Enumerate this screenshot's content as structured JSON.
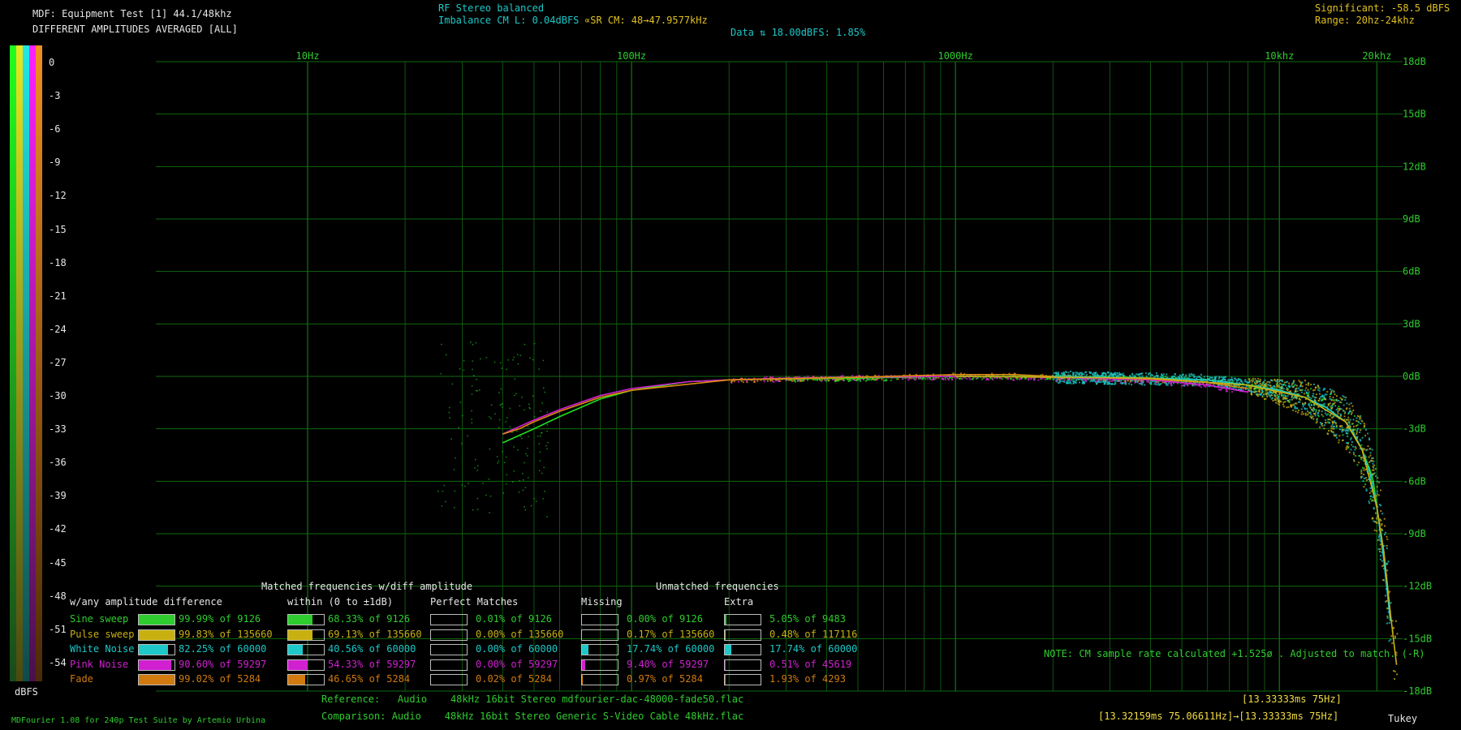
{
  "header": {
    "title": "MDF: Equipment Test [1] 44.1/48khz",
    "subtitle": "DIFFERENT AMPLITUDES AVERAGED [ALL]",
    "rf_line1": "RF Stereo balanced",
    "rf_line2": "Imbalance CM L: 0.04dBFS",
    "sr_cm": "∝SR CM: 48→47.9577kHz",
    "data_line": "Data ⇅ 18.00dBFS: 1.85%",
    "significant": "Significant: -58.5 dBFS",
    "range": "Range: 20hz-24khz"
  },
  "scale": {
    "labels": [
      "0",
      "-3",
      "-6",
      "-9",
      "-12",
      "-15",
      "-18",
      "-21",
      "-24",
      "-27",
      "-30",
      "-33",
      "-36",
      "-39",
      "-42",
      "-45",
      "-48",
      "-51",
      "-54"
    ],
    "unit": "dBFS"
  },
  "chart_data": {
    "type": "scatter",
    "x_scale": "log",
    "x_ticks": [
      "10Hz",
      "100Hz",
      "1000Hz",
      "10khz",
      "20khz"
    ],
    "x_tick_values": [
      10,
      100,
      1000,
      10000,
      20000
    ],
    "y_ticks": [
      "18dB",
      "15dB",
      "12dB",
      "9dB",
      "6dB",
      "3dB",
      "0dB",
      "-3dB",
      "-6dB",
      "-9dB",
      "-12dB",
      "-15dB",
      "-18dB"
    ],
    "y_tick_values": [
      18,
      15,
      12,
      9,
      6,
      3,
      0,
      -3,
      -6,
      -9,
      -12,
      -15,
      -18
    ],
    "xlim": [
      3.4,
      24000
    ],
    "ylim": [
      -18,
      18
    ],
    "grid": true,
    "series": [
      {
        "name": "Sine sweep",
        "color": "#20e020",
        "x": [
          40,
          50,
          60,
          80,
          100,
          150,
          200,
          300,
          500,
          1000,
          2000,
          4000,
          6000,
          8000,
          10000,
          12000,
          14000,
          16000,
          17000,
          18000,
          19000,
          19500,
          20000
        ],
        "y": [
          -3.8,
          -3.0,
          -2.3,
          -1.3,
          -0.8,
          -0.3,
          -0.2,
          -0.15,
          -0.1,
          0.0,
          0.0,
          -0.1,
          -0.2,
          -0.5,
          -0.8,
          -1.2,
          -1.8,
          -2.6,
          -3.3,
          -4.2,
          -5.3,
          -6.0,
          -7.5
        ]
      },
      {
        "name": "Pink Noise",
        "color": "#d020d0",
        "x": [
          40,
          50,
          60,
          80,
          100,
          150,
          200,
          300,
          500,
          1000,
          2000,
          4000,
          6000,
          8000
        ],
        "y": [
          -3.3,
          -2.5,
          -1.9,
          -1.1,
          -0.7,
          -0.3,
          -0.2,
          -0.1,
          -0.05,
          0.0,
          -0.05,
          -0.2,
          -0.5,
          -0.9
        ]
      },
      {
        "name": "Fade",
        "color": "#e08a10",
        "x": [
          40,
          45,
          50,
          60,
          80,
          100,
          200,
          500,
          1000,
          1500,
          2000,
          4000,
          6000,
          8000
        ],
        "y": [
          -3.3,
          -3.0,
          -2.6,
          -2.0,
          -1.2,
          -0.8,
          -0.2,
          -0.05,
          0.1,
          0.1,
          0.0,
          -0.15,
          -0.35,
          -0.7
        ]
      },
      {
        "name": "White Noise",
        "color": "#1ec8c8",
        "x": [
          2000,
          4000,
          6000,
          8000,
          10000,
          12000,
          14000,
          16000,
          17000,
          18000,
          19000,
          20000,
          21000,
          22000
        ],
        "y": [
          0.0,
          -0.1,
          -0.2,
          -0.5,
          -0.8,
          -1.2,
          -1.8,
          -2.6,
          -3.3,
          -4.2,
          -5.5,
          -7.5,
          -10.5,
          -14.0
        ]
      },
      {
        "name": "Pulse sweep",
        "color": "#c8b010",
        "x": [
          1000,
          4000,
          8000,
          12000,
          16000,
          18000,
          20000,
          21000,
          22000,
          23000
        ],
        "y": [
          0.0,
          -0.1,
          -0.5,
          -1.2,
          -2.6,
          -4.2,
          -7.5,
          -10.0,
          -13.5,
          -16.5
        ]
      }
    ]
  },
  "stats": {
    "section_any": "w/any amplitude difference",
    "section_matched": "Matched frequencies w/diff amplitude",
    "section_within": "within (0 to ±1dB)",
    "section_perfect": "Perfect Matches",
    "section_unmatched": "Unmatched frequencies",
    "section_missing": "Missing",
    "section_extra": "Extra",
    "rows": [
      {
        "name": "Sine sweep",
        "color": "#2ecc2e",
        "any": "99.99% of 9126",
        "any_pct": 99.99,
        "within": "68.33% of 9126",
        "within_pct": 68.33,
        "perfect": "0.01% of 9126",
        "perfect_pct": 0.01,
        "missing": "0.00% of 9126",
        "missing_pct": 0,
        "extra": "5.05% of 9483",
        "extra_pct": 5.05
      },
      {
        "name": "Pulse sweep",
        "color": "#c8b010",
        "any": "99.83% of 135660",
        "any_pct": 99.83,
        "within": "69.13% of 135660",
        "within_pct": 69.13,
        "perfect": "0.00% of 135660",
        "perfect_pct": 0,
        "missing": "0.17% of 135660",
        "missing_pct": 0.17,
        "extra": "0.48% of 117116",
        "extra_pct": 0.48
      },
      {
        "name": "White Noise",
        "color": "#1ec8c8",
        "any": "82.25% of 60000",
        "any_pct": 82.25,
        "within": "40.56% of 60000",
        "within_pct": 40.56,
        "perfect": "0.00% of 60000",
        "perfect_pct": 0,
        "missing": "17.74% of 60000",
        "missing_pct": 17.74,
        "extra": "17.74% of 60000",
        "extra_pct": 17.74
      },
      {
        "name": "Pink Noise",
        "color": "#d020d0",
        "any": "90.60% of 59297",
        "any_pct": 90.6,
        "within": "54.33% of 59297",
        "within_pct": 54.33,
        "perfect": "0.00% of 59297",
        "perfect_pct": 0,
        "missing": "9.40% of 59297",
        "missing_pct": 9.4,
        "extra": "0.51% of 45619",
        "extra_pct": 0.51
      },
      {
        "name": "Fade",
        "color": "#d07a10",
        "any": "99.02% of 5284",
        "any_pct": 99.02,
        "within": "46.65% of 5284",
        "within_pct": 46.65,
        "perfect": "0.02% of 5284",
        "perfect_pct": 0.02,
        "missing": "0.97% of 5284",
        "missing_pct": 0.97,
        "extra": "1.93% of 4293",
        "extra_pct": 1.93
      }
    ]
  },
  "footer": {
    "note": "NOTE: CM sample rate calculated +1.525ø . Adjusted to match. (-R)",
    "reference": "Reference:   Audio    48kHz 16bit Stereo mdfourier-dac-48000-fade50.flac",
    "comparison": "Comparison: Audio    48kHz 16bit Stereo Generic S-Video Cable 48kHz.flac",
    "timing1": "[13.33333ms 75Hz]",
    "timing2": "[13.32159ms 75.06611Hz]→[13.33333ms 75Hz]",
    "credits": "MDFourier 1.08 for 240p Test Suite by Artemio Urbina",
    "window": "Tukey"
  },
  "colors": {
    "grid": "#0f6a0f",
    "label": "#2ecc2e"
  }
}
